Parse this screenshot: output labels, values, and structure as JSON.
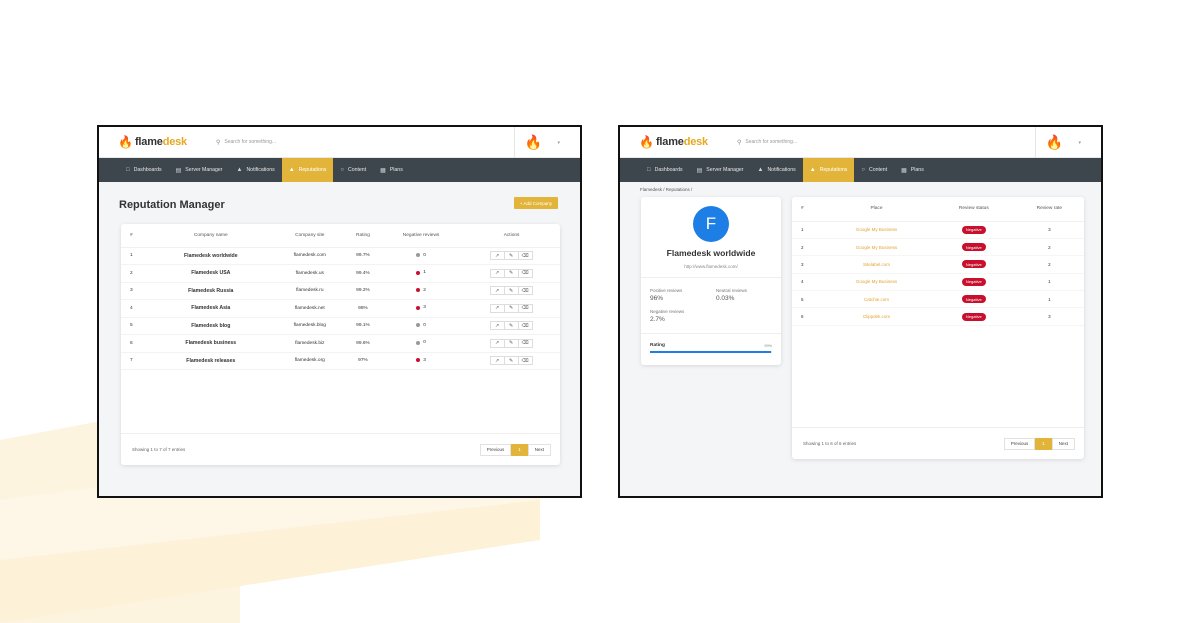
{
  "brand": {
    "name_part1": "flame",
    "name_part2": "desk",
    "accent": "#e2b53a"
  },
  "search": {
    "placeholder": "Search for something..."
  },
  "nav": [
    {
      "label": "Dashboards",
      "icon": "folder-icon"
    },
    {
      "label": "Server Manager",
      "icon": "server-icon"
    },
    {
      "label": "Notifications",
      "icon": "bell-icon"
    },
    {
      "label": "Reputations",
      "icon": "thumbs-up-icon",
      "active": true
    },
    {
      "label": "Content",
      "icon": "globe-icon"
    },
    {
      "label": "Plans",
      "icon": "chart-icon"
    }
  ],
  "screen1": {
    "title": "Reputation Manager",
    "add_button": "+ Add Company",
    "columns": [
      "#",
      "Company name",
      "Company site",
      "Rating",
      "Negative reviews",
      "Actions"
    ],
    "rows": [
      {
        "num": "1",
        "name": "Flamedesk worldwide",
        "site": "flamedesk.com",
        "rating": "99.7%",
        "neg": "0",
        "neg_status": "grey"
      },
      {
        "num": "2",
        "name": "Flamedesk USA",
        "site": "flamedesk.us",
        "rating": "99.4%",
        "neg": "1",
        "neg_status": "red"
      },
      {
        "num": "3",
        "name": "Flamedesk Russia",
        "site": "flamedesk.ru",
        "rating": "99.2%",
        "neg": "2",
        "neg_status": "red"
      },
      {
        "num": "4",
        "name": "Flamedesk Asia",
        "site": "flamedesk.net",
        "rating": "98%",
        "neg": "3",
        "neg_status": "red"
      },
      {
        "num": "5",
        "name": "Flamedesk blog",
        "site": "flamedesk.blog",
        "rating": "99.1%",
        "neg": "0",
        "neg_status": "grey"
      },
      {
        "num": "6",
        "name": "Flamedesk business",
        "site": "flamedesk.biz",
        "rating": "99.6%",
        "neg": "0",
        "neg_status": "grey"
      },
      {
        "num": "7",
        "name": "Flamedesk releases",
        "site": "flamedesk.org",
        "rating": "97%",
        "neg": "3",
        "neg_status": "red"
      }
    ],
    "footer_info": "Showing 1 to 7 of 7 entries",
    "pager": {
      "prev": "Previous",
      "page": "1",
      "next": "Next"
    }
  },
  "screen2": {
    "breadcrumb": "Flamedesk / Reputations /",
    "profile": {
      "initial": "F",
      "name": "Flamedesk worldwide",
      "url": "http://www.flamedesk.com/",
      "positive_label": "Positive reviews",
      "positive_value": "96%",
      "neutral_label": "Neutral reviews",
      "neutral_value": "0.03%",
      "negative_label": "Negative reviews",
      "negative_value": "2.7%",
      "rating_label": "Rating",
      "rating_pct": "99%",
      "rating_fraction": 0.99
    },
    "columns": [
      "#",
      "Place",
      "Review status",
      "Review rate"
    ],
    "rows": [
      {
        "num": "1",
        "place": "Google My Business",
        "status": "Negative",
        "rate": "3"
      },
      {
        "num": "2",
        "place": "Google My Business",
        "status": "Negative",
        "rate": "2"
      },
      {
        "num": "3",
        "place": "Sitelabel.com",
        "status": "Negative",
        "rate": "2"
      },
      {
        "num": "4",
        "place": "Google My Business",
        "status": "Negative",
        "rate": "1"
      },
      {
        "num": "5",
        "place": "Catchie.com",
        "status": "Negative",
        "rate": "1"
      },
      {
        "num": "6",
        "place": "Clippdek.com",
        "status": "Negative",
        "rate": "3"
      }
    ],
    "footer_info": "Showing 1 to 6 of 6 entries",
    "pager": {
      "prev": "Previous",
      "page": "1",
      "next": "Next"
    }
  }
}
